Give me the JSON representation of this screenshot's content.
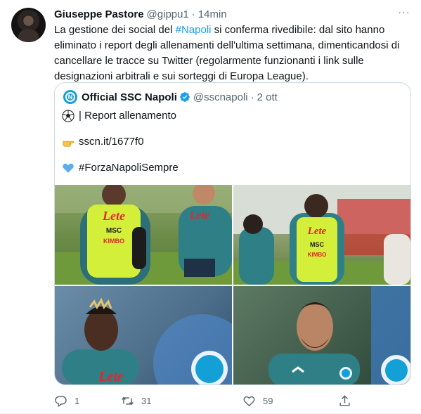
{
  "author": {
    "name": "Giuseppe Pastore",
    "handle": "@gippu1",
    "separator": "·",
    "time": "14min"
  },
  "more_label": "···",
  "tweet": {
    "text_before": "La gestione dei social del ",
    "hashtag": "#Napoli",
    "text_after": " si conferma rivedibile: dal sito hanno eliminato i report degli allenamenti dell'ultima settimana, dimenticandosi di cancellare le tracce su Twitter (regolarmente funzionanti i link sulle designazioni arbitrali e sui sorteggi di Europa League)."
  },
  "quoted": {
    "name": "Official SSC Napoli",
    "handle": "@sscnapoli",
    "separator": "·",
    "time": "2 ott",
    "line1": "| Report allenamento",
    "line2": "sscn.it/1677f0",
    "line3": "#ForzaNapoliSempre",
    "line1_icon": "soccer-ball-icon",
    "line2_icon": "pointing-hand-icon",
    "line3_icon": "blue-heart-icon",
    "photos": [
      {
        "label": "training-photo-1",
        "sponsor": "Lete",
        "bib_text": "MSC",
        "bib_text2": "KIMBO"
      },
      {
        "label": "training-photo-2",
        "sponsor": "Lete",
        "bib_text": "MSC",
        "bib_text2": "KIMBO"
      },
      {
        "label": "training-photo-3",
        "sponsor": "Lete"
      },
      {
        "label": "training-photo-4"
      }
    ]
  },
  "actions": {
    "reply_count": "1",
    "retweet_count": "31",
    "like_count": "59"
  },
  "colors": {
    "accent": "#1d9bf0",
    "muted": "#536471",
    "text": "#0f1419",
    "border": "#cfd9de",
    "bib": "#d4ef3a",
    "jersey": "#2f7f86"
  }
}
